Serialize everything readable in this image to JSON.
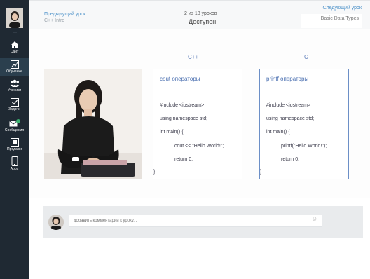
{
  "sidebar": {
    "items": [
      {
        "label": "Сайт",
        "icon": "home-icon"
      },
      {
        "label": "Обучение",
        "icon": "chart-icon"
      },
      {
        "label": "Ученики",
        "icon": "users-icon"
      },
      {
        "label": "Задачи",
        "icon": "checkbox-icon"
      },
      {
        "label": "Сообщения",
        "icon": "mail-icon",
        "badge": "3"
      },
      {
        "label": "Продажи",
        "icon": "sales-icon"
      },
      {
        "label": "Apps",
        "icon": "phone-icon"
      }
    ]
  },
  "topbar": {
    "prev_label": "Предыдущий урок",
    "prev_title": "C++ Intro",
    "count": "2 из 18 уроков",
    "status": "Доступен",
    "next_label": "Следующий урок",
    "next_title": "Basic Data Types"
  },
  "lesson": {
    "left": {
      "language": "C++",
      "title": "cout операторы",
      "lines": [
        "#include <iostream>",
        "using namespace std;",
        "int main() {",
        "cout << \"Hello World!\";",
        "return 0;",
        "}"
      ]
    },
    "right": {
      "language": "C",
      "title": "printf операторы",
      "lines": [
        "#include <iostream>",
        "using namespace std;",
        "int main() {",
        "printf(\"Hello World!\");",
        "return 0;",
        "}"
      ]
    }
  },
  "comments": {
    "placeholder": "добавить комментарий к уроку..."
  },
  "colors": {
    "sidebar_bg": "#1f2933",
    "accent": "#4a90c8",
    "code_border": "#6c8fc7",
    "badge": "#3cb371"
  }
}
